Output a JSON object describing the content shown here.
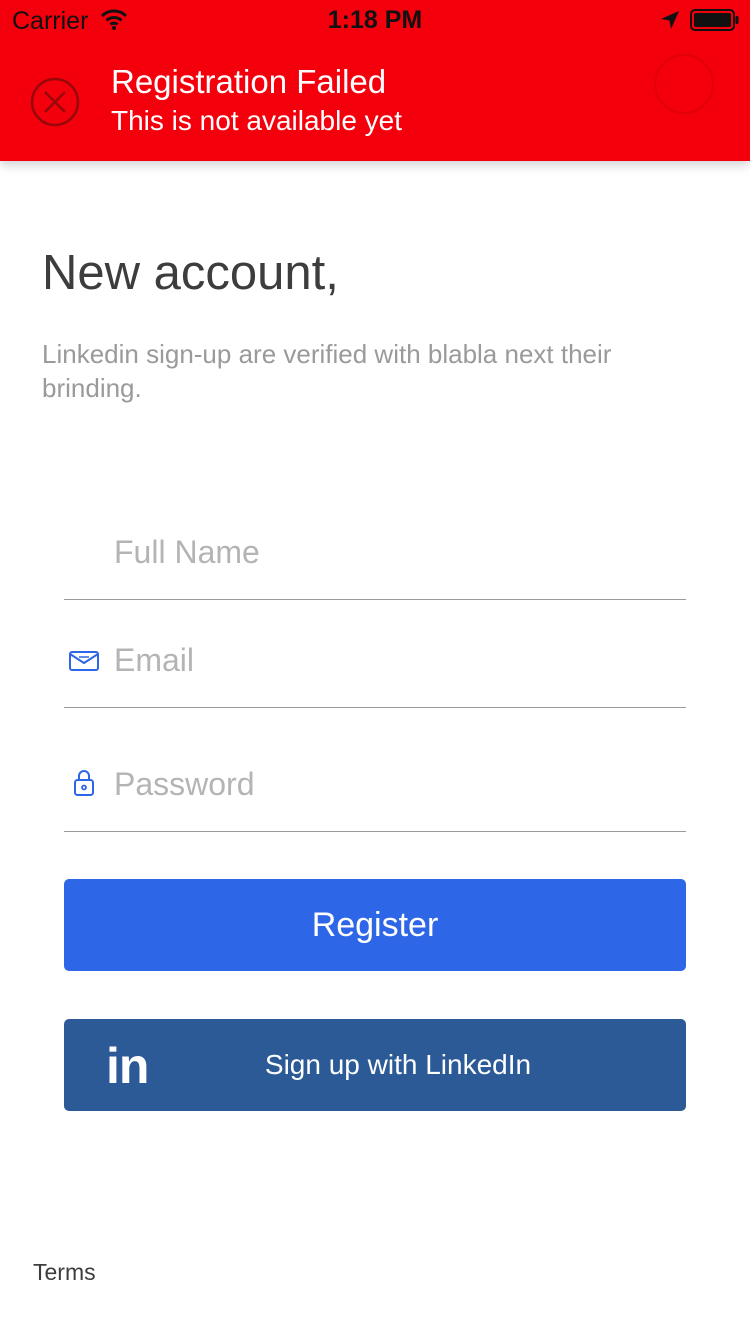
{
  "status_bar": {
    "carrier": "Carrier",
    "time": "1:18 PM"
  },
  "alert": {
    "title": "Registration Failed",
    "message": "This is not available yet",
    "icon": "close-circle-icon",
    "background_color": "#f4000c"
  },
  "header": {
    "title": "New account,",
    "subtitle": "Linkedin sign-up are verified with blabla next their brinding."
  },
  "form": {
    "full_name_placeholder": "Full Name",
    "email_placeholder": "Email",
    "password_placeholder": "Password",
    "email_icon": "envelope-icon",
    "password_icon": "lock-icon"
  },
  "buttons": {
    "register_label": "Register",
    "register_color": "#2e66e8",
    "linkedin_logo": "in",
    "linkedin_label": "Sign up with LinkedIn",
    "linkedin_color": "#2c5a96"
  },
  "footer": {
    "terms_label": "Terms"
  }
}
